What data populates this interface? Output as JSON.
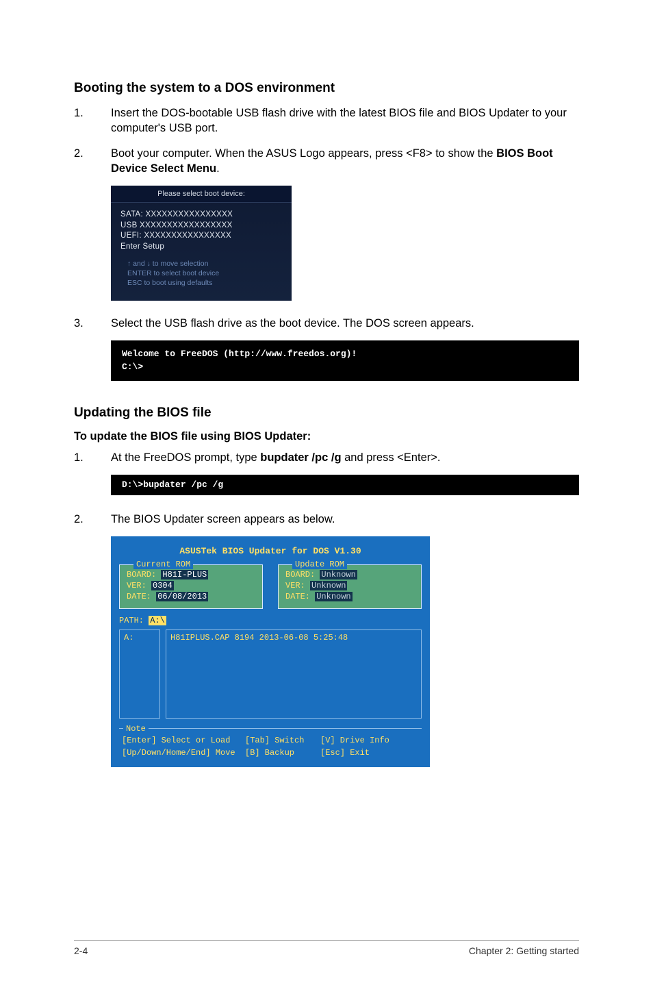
{
  "section1": {
    "heading": "Booting the system to a DOS environment",
    "steps": [
      {
        "num": "1.",
        "text_a": "Insert the DOS-bootable USB flash drive with the latest BIOS file and BIOS Updater to your computer's USB port."
      },
      {
        "num": "2.",
        "text_a": "Boot your computer. When the ASUS Logo appears, press <F8> to show the ",
        "bold_a": "BIOS Boot Device Select Menu",
        "text_b": "."
      },
      {
        "num": "3.",
        "text_a": "Select the USB flash drive as the boot device. The DOS screen appears."
      }
    ]
  },
  "boot": {
    "title": "Please select boot device:",
    "items": [
      "SATA: XXXXXXXXXXXXXXXX",
      "USB XXXXXXXXXXXXXXXXX",
      "UEFI: XXXXXXXXXXXXXXXX",
      "Enter Setup"
    ],
    "hints": [
      "↑ and ↓ to move selection",
      "ENTER to select boot device",
      "ESC to boot using defaults"
    ]
  },
  "term1": {
    "line1": "Welcome to FreeDOS (http://www.freedos.org)!",
    "line2": "C:\\>"
  },
  "section2": {
    "heading": "Updating the BIOS file",
    "sub": "To update the BIOS file using BIOS Updater:",
    "steps": [
      {
        "num": "1.",
        "text_a": "At the FreeDOS prompt, type ",
        "bold_a": "bupdater /pc /g",
        "text_b": " and press <Enter>."
      },
      {
        "num": "2.",
        "text_a": "The BIOS Updater screen appears as below."
      }
    ]
  },
  "term2": {
    "line1": "D:\\>bupdater /pc /g"
  },
  "updater": {
    "title": "ASUSTek BIOS Updater for DOS V1.30",
    "current": {
      "legend": "Current ROM",
      "board_lbl": "BOARD:",
      "board_val": "H81I-PLUS",
      "ver_lbl": "VER:",
      "ver_val": "0304",
      "date_lbl": "DATE:",
      "date_val": "06/08/2013"
    },
    "update": {
      "legend": "Update ROM",
      "board_lbl": "BOARD:",
      "board_val": "Unknown",
      "ver_lbl": "VER:",
      "ver_val": "Unknown",
      "date_lbl": "DATE:",
      "date_val": "Unknown"
    },
    "path_lbl": "PATH:",
    "path_val": "A:\\",
    "drive": "A:",
    "file": "H81IPLUS.CAP 8194 2013-06-08 5:25:48",
    "note_legend": "Note",
    "note": {
      "r1c1": "[Enter] Select or Load",
      "r1c2": "[Tab] Switch",
      "r1c3": "[V] Drive Info",
      "r2c1": "[Up/Down/Home/End] Move",
      "r2c2": "[B] Backup",
      "r2c3": "[Esc] Exit"
    }
  },
  "footer": {
    "page": "2-4",
    "chapter": "Chapter 2: Getting started"
  }
}
